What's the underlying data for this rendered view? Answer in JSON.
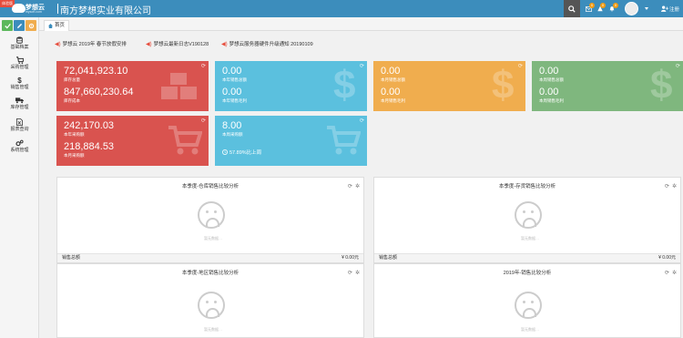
{
  "brand": {
    "ribbon": "体验版",
    "logo_text": "梦想云",
    "logo_sub": "mysoft.com",
    "company": "南方梦想实业有限公司",
    "colors": {
      "topbar": "#3c8dbc",
      "sidebar": "#f5f5f5"
    }
  },
  "topbar": {
    "badges": {
      "mail": "0",
      "warning": "0",
      "alert": "0"
    },
    "register_label": "注册"
  },
  "sidebar": {
    "tools": [
      {
        "icon": "check-icon",
        "color": "#5cb85c"
      },
      {
        "icon": "edit-icon",
        "color": "#3c8dbc"
      },
      {
        "icon": "gear-icon",
        "color": "#f0ad4e"
      }
    ],
    "items": [
      {
        "label": "基础档案",
        "icon": "database-icon"
      },
      {
        "label": "采购管理",
        "icon": "cart-icon"
      },
      {
        "label": "销售管理",
        "icon": "dollar-icon"
      },
      {
        "label": "库存管理",
        "icon": "truck-icon"
      },
      {
        "label": "报表查询",
        "icon": "excel-icon"
      },
      {
        "label": "系统管理",
        "icon": "gears-icon"
      }
    ]
  },
  "tabs": [
    {
      "label": "首页",
      "icon": "home-icon"
    }
  ],
  "notices": [
    {
      "text": "梦想云 2019年 春节放假安排"
    },
    {
      "text": "梦想云最新日志V190128"
    },
    {
      "text": "梦想云服务器硬件升级通知 20190109"
    }
  ],
  "cards": [
    {
      "color": "#d9534f",
      "icon": "cubes-icon",
      "v1": "72,041,923.10",
      "l1": "库存总量",
      "v2": "847,660,230.64",
      "l2": "库存成本"
    },
    {
      "color": "#5bc0de",
      "icon": "dollar-icon",
      "v1": "0.00",
      "l1": "本年销售总额",
      "v2": "0.00",
      "l2": "本年销售毛利"
    },
    {
      "color": "#f0ad4e",
      "icon": "dollar-icon",
      "v1": "0.00",
      "l1": "本月销售总额",
      "v2": "0.00",
      "l2": "本月销售毛利"
    },
    {
      "color": "#7fb77e",
      "icon": "dollar-icon",
      "v1": "0.00",
      "l1": "本周销售总额",
      "v2": "0.00",
      "l2": "本周销售毛利"
    },
    {
      "color": "#d9534f",
      "icon": "cart-icon",
      "v1": "242,170.03",
      "l1": "本年采购额",
      "v2": "218,884.53",
      "l2": "本月采购额"
    },
    {
      "color": "#5bc0de",
      "icon": "cart-icon",
      "v1": "8.00",
      "l1": "本周采购额",
      "v2": "57.89%比上周",
      "l2": ""
    }
  ],
  "panels": [
    {
      "title": "本季度-仓库销售比较分析",
      "empty": "暂无数据…",
      "footer_label": "销售总额",
      "footer_value": "¥ 0.00元"
    },
    {
      "title": "本季度-存货销售比较分析",
      "empty": "暂无数据…",
      "footer_label": "销售总额",
      "footer_value": "¥ 0.00元"
    },
    {
      "title": "本季度-地区销售比较分析",
      "empty": "暂无数据…"
    },
    {
      "title": "2019年-销售比较分析",
      "empty": "暂无数据…"
    }
  ]
}
